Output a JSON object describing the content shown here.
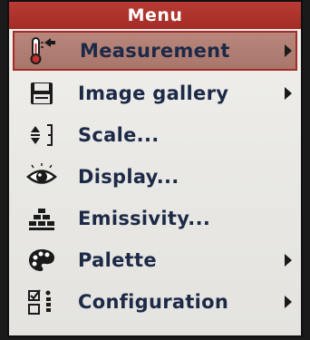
{
  "menu": {
    "title": "Menu",
    "items": [
      {
        "label": "Measurement",
        "icon": "thermometer-icon",
        "has_submenu": true,
        "selected": true
      },
      {
        "label": "Image gallery",
        "icon": "floppy-disk-icon",
        "has_submenu": true,
        "selected": false
      },
      {
        "label": "Scale...",
        "icon": "scale-icon",
        "has_submenu": false,
        "selected": false
      },
      {
        "label": "Display...",
        "icon": "eye-icon",
        "has_submenu": false,
        "selected": false
      },
      {
        "label": "Emissivity...",
        "icon": "bricks-icon",
        "has_submenu": false,
        "selected": false
      },
      {
        "label": "Palette",
        "icon": "palette-icon",
        "has_submenu": true,
        "selected": false
      },
      {
        "label": "Configuration",
        "icon": "configuration-icon",
        "has_submenu": true,
        "selected": false
      }
    ]
  },
  "colors": {
    "title_bar": "#a32c27",
    "selected_row": "#b08076",
    "text": "#1c2a48",
    "background": "#ecebe7"
  }
}
